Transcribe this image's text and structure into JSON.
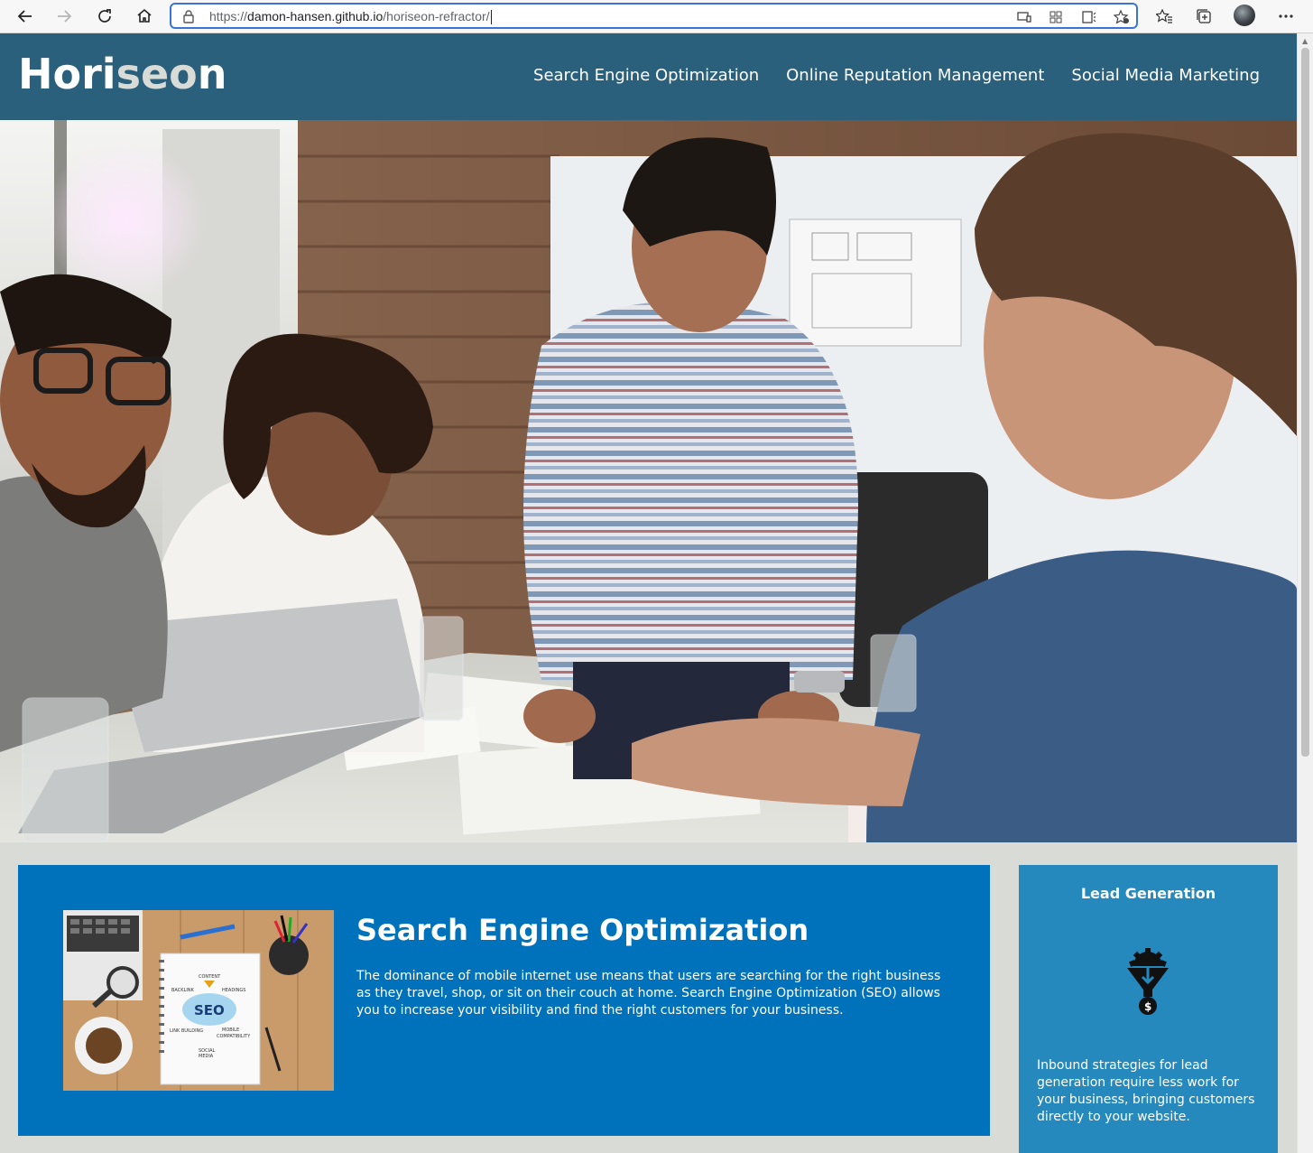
{
  "browser": {
    "url_prefix": "https://",
    "url_domain": "damon-hansen.github.io",
    "url_path": "/horiseon-refractor/"
  },
  "site": {
    "logo_prefix": "Hori",
    "logo_highlight": "seo",
    "logo_suffix": "n",
    "nav": [
      {
        "label": "Search Engine Optimization"
      },
      {
        "label": "Online Reputation Management"
      },
      {
        "label": "Social Media Marketing"
      }
    ]
  },
  "hero": {
    "alt": "team meeting photo"
  },
  "content": {
    "seo": {
      "title": "Search Engine Optimization",
      "body": "The dominance of mobile internet use means that users are searching for the right business as they travel, shop, or sit on their couch at home. Search Engine Optimization (SEO) allows you to increase your visibility and find the right customers for your business."
    }
  },
  "aside": {
    "lead": {
      "title": "Lead Generation",
      "icon": "lead-funnel-icon",
      "body": "Inbound strategies for lead generation require less work for your business, bringing customers directly to your website."
    }
  },
  "colors": {
    "header": "#2a607c",
    "page_bg": "#d9dcd6",
    "content_bg": "#0072bb",
    "aside_bg": "#2589bd"
  }
}
